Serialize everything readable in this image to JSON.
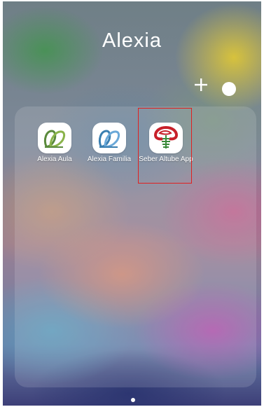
{
  "folder": {
    "title": "Alexia",
    "add_symbol": "+"
  },
  "apps": [
    {
      "label": "Alexia Aula",
      "icon": "alexia-aula-icon"
    },
    {
      "label": "Alexia Familia",
      "icon": "alexia-familia-icon"
    },
    {
      "label": "Seber Altube App",
      "icon": "seber-altube-icon"
    }
  ],
  "colors": {
    "highlight": "#e02020",
    "alexia_aula_green": "#5a8a3c",
    "alexia_familia_blue": "#3a7fb0",
    "seber_red": "#c8202a",
    "seber_green": "#3a8a3a"
  }
}
